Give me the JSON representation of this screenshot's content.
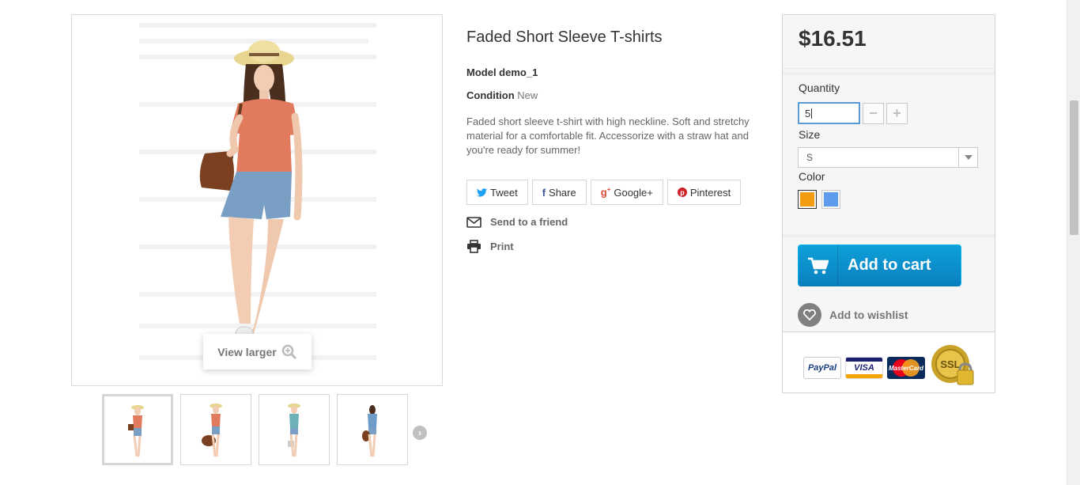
{
  "product": {
    "title": "Faded Short Sleeve T-shirts",
    "model_line": "Model demo_1",
    "condition_label": "Condition",
    "condition_value": "New",
    "description": "Faded short sleeve t-shirt with high neckline. Soft and stretchy material for a comfortable fit. Accessorize with a straw hat and you're ready for summer!"
  },
  "image": {
    "view_larger_label": "View larger",
    "thumbnail_count": 4,
    "selected_thumbnail": 1
  },
  "share": {
    "tweet": "Tweet",
    "share": "Share",
    "googleplus": "Google+",
    "pinterest": "Pinterest",
    "tweet_icon": "twitter-icon",
    "share_icon": "facebook-icon",
    "googleplus_icon": "googleplus-icon",
    "pinterest_icon": "pinterest-icon"
  },
  "links": {
    "send_to_friend": "Send to a friend",
    "print": "Print"
  },
  "buybox": {
    "price": "$16.51",
    "quantity_label": "Quantity",
    "quantity_value": "5",
    "size_label": "Size",
    "size_value": "S",
    "color_label": "Color",
    "colors": [
      "#f39c11",
      "#5d9cec"
    ],
    "selected_color": 0,
    "add_to_cart": "Add to cart",
    "add_to_wishlist": "Add to wishlist",
    "accent_color": "#0a8fcf"
  },
  "payments": {
    "paypal": "PayPal",
    "visa": "VISA",
    "mastercard": "MasterCard",
    "ssl": "SSL"
  }
}
